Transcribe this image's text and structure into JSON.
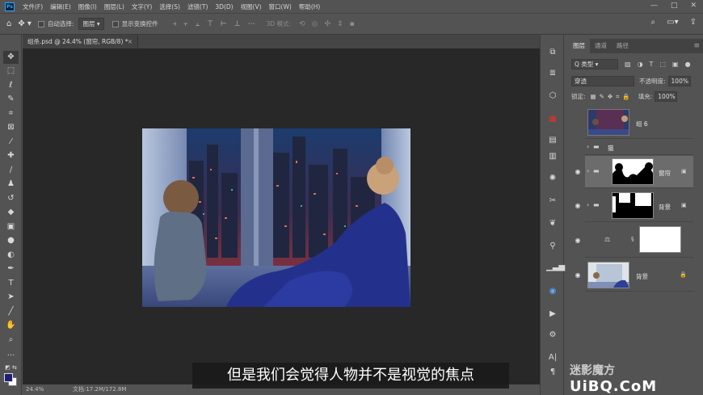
{
  "app": {
    "logo": "Ps"
  },
  "menu": [
    "文件(F)",
    "编辑(E)",
    "图像(I)",
    "图层(L)",
    "文字(Y)",
    "选择(S)",
    "滤镜(T)",
    "3D(D)",
    "视图(V)",
    "窗口(W)",
    "帮助(H)"
  ],
  "window_controls": {
    "minimize": "—",
    "restore": "□",
    "close": "✕"
  },
  "options": {
    "auto_select_label": "自动选择:",
    "auto_select_value": "图层",
    "show_transform_label": "显示变换控件",
    "mode_3d": "3D 模式:"
  },
  "document": {
    "tab_title": "组杀.psd @ 24.4% (窗帘, RGB/8) *",
    "close": "×"
  },
  "status": {
    "zoom": "24.4%",
    "doc_size": "文档:17.2M/172.8M"
  },
  "subtitle": "但是我们会觉得人物并不是视觉的焦点",
  "layers_panel": {
    "tabs": [
      "图层",
      "通道",
      "路径"
    ],
    "filter_type": "Q 类型",
    "blend_mode": "穿透",
    "opacity_label": "不透明度:",
    "opacity_value": "100%",
    "lock_label": "锁定:",
    "fill_label": "填充:",
    "fill_value": "100%",
    "layers": [
      {
        "name": "组 6"
      },
      {
        "name": "猫"
      },
      {
        "name": "窗帘"
      },
      {
        "name": "背景"
      },
      {
        "name": ""
      },
      {
        "name": "背景"
      }
    ]
  },
  "watermark": {
    "line1": "迷影魔方",
    "line2": "UiBQ.CoM"
  },
  "colors": {
    "foreground": "#1d1e77",
    "background": "#ffffff",
    "canvas": "#282828",
    "ui": "#535353"
  }
}
